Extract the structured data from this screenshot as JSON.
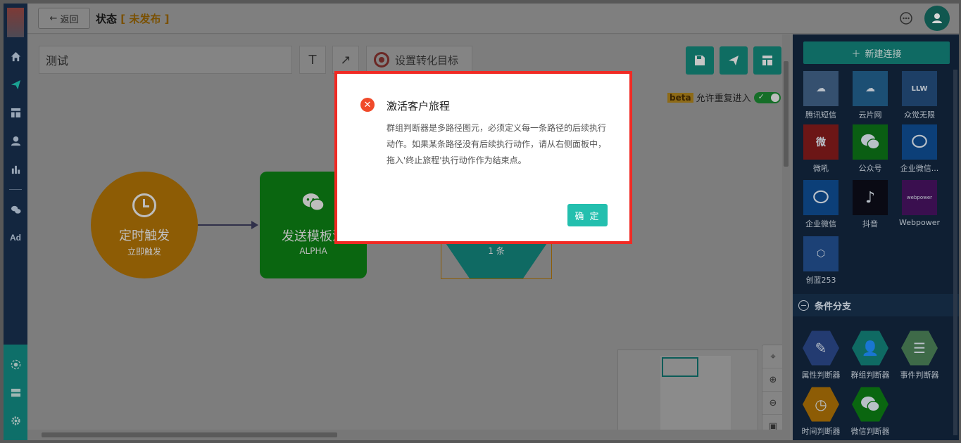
{
  "topbar": {
    "back_label": "返回",
    "title": "状态",
    "status_open": "[",
    "status": "未发布",
    "status_close": "]"
  },
  "leftnav": {
    "items": [
      "home-icon",
      "send-icon",
      "layout-icon",
      "user-icon",
      "bar-chart-icon",
      "wechat-icon",
      "ad-icon"
    ],
    "ad_label": "Ad"
  },
  "canvas": {
    "journey_name": "测试",
    "text_tool": "T",
    "arrow_tool": "↗",
    "goal_label": "设置转化目标",
    "beta": "beta",
    "reentry_label": "允许重复进入",
    "nodes": {
      "timer_title": "定时触发",
      "timer_sub": "立即触发",
      "wechat_title": "发送模板消",
      "wechat_sub": "ALPHA",
      "group_count": "1 条"
    }
  },
  "rightpanel": {
    "new_connection": "新建连接",
    "channels": [
      {
        "label": "腾讯短信",
        "color": "#35506f"
      },
      {
        "label": "云片网",
        "color": "#1c4f74"
      },
      {
        "label": "众觉无限",
        "color": "#1d3f66"
      },
      {
        "label": "微吼",
        "color": "#6c1616"
      },
      {
        "label": "公众号",
        "color": "#0a5e13"
      },
      {
        "label": "企业微信...",
        "color": "#0c3f78"
      },
      {
        "label": "企业微信",
        "color": "#0c3f78"
      },
      {
        "label": "抖音",
        "color": "#0a0a14"
      },
      {
        "label": "Webpower",
        "color": "#3a0f4f"
      },
      {
        "label": "创蓝253",
        "color": "#1c4176"
      }
    ],
    "section_title": "条件分支",
    "conditions": [
      {
        "label": "属性判断器",
        "color": "#233b71"
      },
      {
        "label": "群组判断器",
        "color": "#0f6a63"
      },
      {
        "label": "事件判断器",
        "color": "#3e6a48"
      },
      {
        "label": "时间判断器",
        "color": "#8d5c05"
      },
      {
        "label": "微信判断器",
        "color": "#0a6610"
      }
    ]
  },
  "modal": {
    "title": "激活客户旅程",
    "body": "群组判断器是多路径图元，必须定义每一条路径的后续执行动作。如果某条路径没有后续执行动作，请从右侧面板中，拖入'终止旅程'执行动作作为结束点。",
    "ok_label": "确 定"
  }
}
